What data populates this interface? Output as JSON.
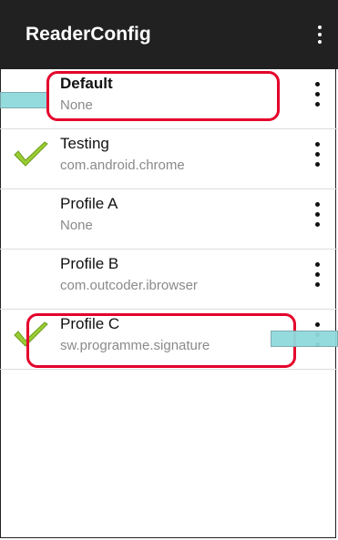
{
  "app": {
    "title": "ReaderConfig",
    "overflow_icon": "more-vert-icon"
  },
  "profiles": [
    {
      "name": "Default",
      "subtitle": "None",
      "active": false,
      "bold": true
    },
    {
      "name": "Testing",
      "subtitle": "com.android.chrome",
      "active": true,
      "bold": false
    },
    {
      "name": "Profile A",
      "subtitle": "None",
      "active": false,
      "bold": false
    },
    {
      "name": "Profile B",
      "subtitle": "com.outcoder.ibrowser",
      "active": false,
      "bold": false
    },
    {
      "name": "Profile C",
      "subtitle": "sw.programme.signature",
      "active": true,
      "bold": false
    }
  ],
  "colors": {
    "appbar": "#212121",
    "highlight": "#e4002b",
    "check_light": "#9acd32",
    "check_dark": "#6b9b1e",
    "callout": "#8fdadd"
  }
}
